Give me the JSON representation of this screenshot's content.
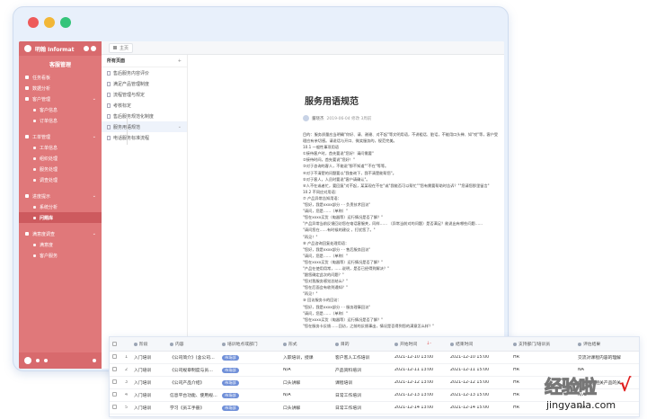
{
  "window": {
    "title": ""
  },
  "sidebar": {
    "brand": "明翰 Informat",
    "workspace": "客服管理",
    "items": [
      {
        "label": "任务看板",
        "type": "item"
      },
      {
        "label": "数据分析",
        "type": "item"
      },
      {
        "label": "客户管理",
        "type": "group"
      },
      {
        "label": "客户信息",
        "type": "sub"
      },
      {
        "label": "订单信息",
        "type": "sub"
      },
      {
        "label": "工单管理",
        "type": "group"
      },
      {
        "label": "工单信息",
        "type": "sub"
      },
      {
        "label": "组织处理",
        "type": "sub"
      },
      {
        "label": "服务处理",
        "type": "sub"
      },
      {
        "label": "调查处理",
        "type": "sub"
      },
      {
        "label": "进度提示",
        "type": "group"
      },
      {
        "label": "系统分析",
        "type": "sub"
      },
      {
        "label": "问题库",
        "type": "sub",
        "active": true
      },
      {
        "label": "满意度调查",
        "type": "group"
      },
      {
        "label": "满意度",
        "type": "sub"
      },
      {
        "label": "客户服务",
        "type": "sub"
      }
    ]
  },
  "topbar": {
    "home_tab": "主页"
  },
  "pagelist": {
    "header": "所有页面",
    "add": "+",
    "items": [
      {
        "label": "售后服务内容评价"
      },
      {
        "label": "满足产品管理制度"
      },
      {
        "label": "流程管理与规定"
      },
      {
        "label": "考核标定"
      },
      {
        "label": "售后服务规范化制度"
      },
      {
        "label": "服务用语规范",
        "active": true
      },
      {
        "label": "电话服务标准流程"
      }
    ]
  },
  "doc": {
    "title": "服务用语规范",
    "author": "董晓杰",
    "meta": "2019-06-04  修改  3周前",
    "lines": [
      "目的：服务质量应当明确\"你好、请、谢谢、对不起\"等文明用语，不讲粗话、脏话，不能用口头禅、如\"哎\"等，客户受",
      "理应有亲切感。请说话与开口、微笑服务的，规范完美。",
      "10.1 一般性事项用语",
      "①接待客户时，首先要说\"您好！请问需要\"",
      "②接待时间，首先要说\"您好！\"",
      "③对于咨询的客人，不能说\"那不知道\"\"不在\"等等。",
      "④对于不清楚的问题要以\"我查询下，我不清楚能帮您\"。",
      "⑤对于客人，人员时要说\"客户请确认\"。",
      "⑥人不在或者忙，要回复\"对不起，某某现在不在\"或\"我能否可以帮忙\"\"您有需要帮助时告诉？\"\"您请您那里留言\"",
      "10.2 不同应对用语：",
      "⑦ 产品异常告知用语：",
      "\"您好，我是xxxx部分 - - 负责技术回访\"",
      "\"请问，您是……（单称）\"",
      "\"您在xxxx买货（电器等）运行情况是否了解？\"",
      "\"产品异常当前反馈回访您在电话客服关，同样…… （异常当前对的问题）是否满足？能说出有哪些问题……",
      "\"请问您在……有时候的建议 ，打扰您了。\"",
      "\"再见！\"",
      "⑧ 产品咨询回复处理用语：",
      "\"您好，我是xxxx部分 - - 售后服务回访\"",
      "\"请问，您是……（单称）\"",
      "\"您在xxxx买货（电器等）运行情况是否了解？\"",
      "\"产品在使用用常，……说明，是否已经得到解决？\"",
      "\"跟您确定此次的问题？\"",
      "\"您对我服务感觉总结么？\"",
      "\"您在后面会有收到通知？\"",
      "\"再见！\"",
      "⑨ 回访服务卡的回访：",
      "\"您好，我是xxxx部分 - - 服务理事回访\"",
      "\"请问，您是……（单称）\"",
      "\"您在xxxx买货（电器等）运行情况是否了解？\"",
      "\"您在服务卡反馈……回访，之前的反馈事出，情况是否得到您的满意怎么样？\""
    ]
  },
  "table": {
    "columns": [
      "阶段",
      "内容",
      "培训地点或部门",
      "形式",
      "目的",
      "开始时间",
      "结束时间",
      "支持部门/培训员",
      "评估结果"
    ],
    "sort_badge": "↓-",
    "rows": [
      {
        "num": "1",
        "stage": "入门培训",
        "content": "《公司简介》(含公司…",
        "tag": "市场部",
        "form": "入职培训，授课",
        "goal": "客户客人工作培训",
        "start": "2021-12-10 13:00",
        "end": "2021-12-10 15:00",
        "support": "HR",
        "result": "交流对课程内容的理解"
      },
      {
        "num": "2",
        "stage": "入门培训",
        "content": "《公司规章制度与员…",
        "tag": "市场部",
        "form": "N/A",
        "goal": "产品资料培训",
        "start": "2021-12-11 13:00",
        "end": "2021-12-11 15:00",
        "support": "HR",
        "result": "NA"
      },
      {
        "num": "3",
        "stage": "入门培训",
        "content": "《公司产品介绍》",
        "tag": "市场部",
        "form": "口头讲解",
        "goal": "课程培训",
        "start": "2021-12-12 13:00",
        "end": "2021-12-12 15:00",
        "support": "HR",
        "result": "如何理解相关产品的关"
      },
      {
        "num": "4",
        "stage": "入门培训",
        "content": "信息平台功能、使用规…",
        "tag": "市场部",
        "form": "N/A",
        "goal": "日常工作培训",
        "start": "2021-12-13 13:00",
        "end": "2021-12-13 15:00",
        "support": "HR",
        "result": "N/A"
      },
      {
        "num": "5",
        "stage": "入门培训",
        "content": "学习《员工手册》",
        "tag": "市场部",
        "form": "口头讲解",
        "goal": "日常工作培训",
        "start": "2021-12-14 13:00",
        "end": "2021-12-14 15:00",
        "support": "HR",
        "result": "N/A"
      }
    ]
  },
  "watermark": {
    "text": "经验啦",
    "check": "√",
    "url": "jingyanla.com"
  }
}
